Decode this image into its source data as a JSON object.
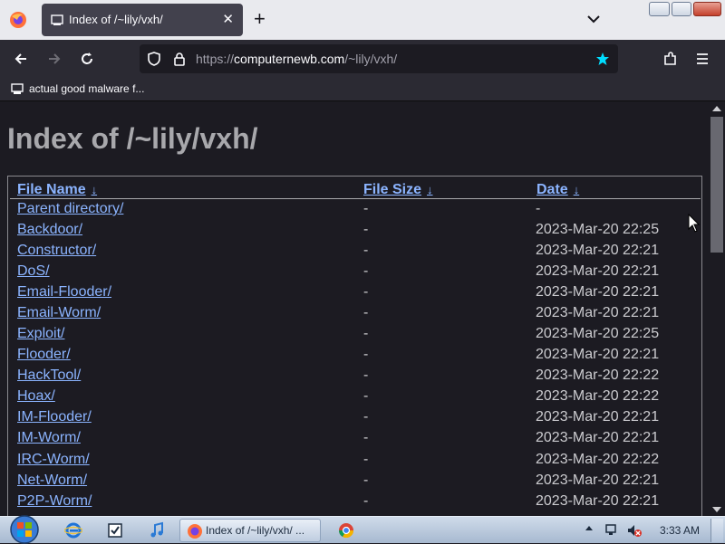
{
  "browser": {
    "tab": {
      "title": "Index of /~lily/vxh/",
      "close_glyph": "✕"
    },
    "new_tab_glyph": "+",
    "url": {
      "prefix": "https://",
      "host": "computernewb.com",
      "path": "/~lily/vxh/"
    },
    "bookmark": {
      "label": "actual good malware f..."
    },
    "colors": {
      "accent_star": "#00ddff",
      "link": "#8bb4ff"
    }
  },
  "page": {
    "title": "Index of /~lily/vxh/",
    "columns": [
      {
        "label": "File Name",
        "sort_glyph": "↓"
      },
      {
        "label": "File Size",
        "sort_glyph": "↓"
      },
      {
        "label": "Date",
        "sort_glyph": "↓"
      }
    ],
    "rows": [
      {
        "name": "Parent directory/",
        "size": "-",
        "date": "-"
      },
      {
        "name": "Backdoor/",
        "size": "-",
        "date": "2023-Mar-20 22:25"
      },
      {
        "name": "Constructor/",
        "size": "-",
        "date": "2023-Mar-20 22:21"
      },
      {
        "name": "DoS/",
        "size": "-",
        "date": "2023-Mar-20 22:21"
      },
      {
        "name": "Email-Flooder/",
        "size": "-",
        "date": "2023-Mar-20 22:21"
      },
      {
        "name": "Email-Worm/",
        "size": "-",
        "date": "2023-Mar-20 22:21"
      },
      {
        "name": "Exploit/",
        "size": "-",
        "date": "2023-Mar-20 22:25"
      },
      {
        "name": "Flooder/",
        "size": "-",
        "date": "2023-Mar-20 22:21"
      },
      {
        "name": "HackTool/",
        "size": "-",
        "date": "2023-Mar-20 22:22"
      },
      {
        "name": "Hoax/",
        "size": "-",
        "date": "2023-Mar-20 22:22"
      },
      {
        "name": "IM-Flooder/",
        "size": "-",
        "date": "2023-Mar-20 22:21"
      },
      {
        "name": "IM-Worm/",
        "size": "-",
        "date": "2023-Mar-20 22:21"
      },
      {
        "name": "IRC-Worm/",
        "size": "-",
        "date": "2023-Mar-20 22:22"
      },
      {
        "name": "Net-Worm/",
        "size": "-",
        "date": "2023-Mar-20 22:21"
      },
      {
        "name": "P2P-Worm/",
        "size": "-",
        "date": "2023-Mar-20 22:21"
      }
    ]
  },
  "taskbar": {
    "active_window_label": "Index of /~lily/vxh/ ...",
    "clock": "3:33 AM",
    "icons": [
      "windows-start-icon",
      "internet-explorer-icon",
      "checkbox-app-icon",
      "itunes-icon",
      "firefox-icon",
      "chrome-icon"
    ]
  }
}
